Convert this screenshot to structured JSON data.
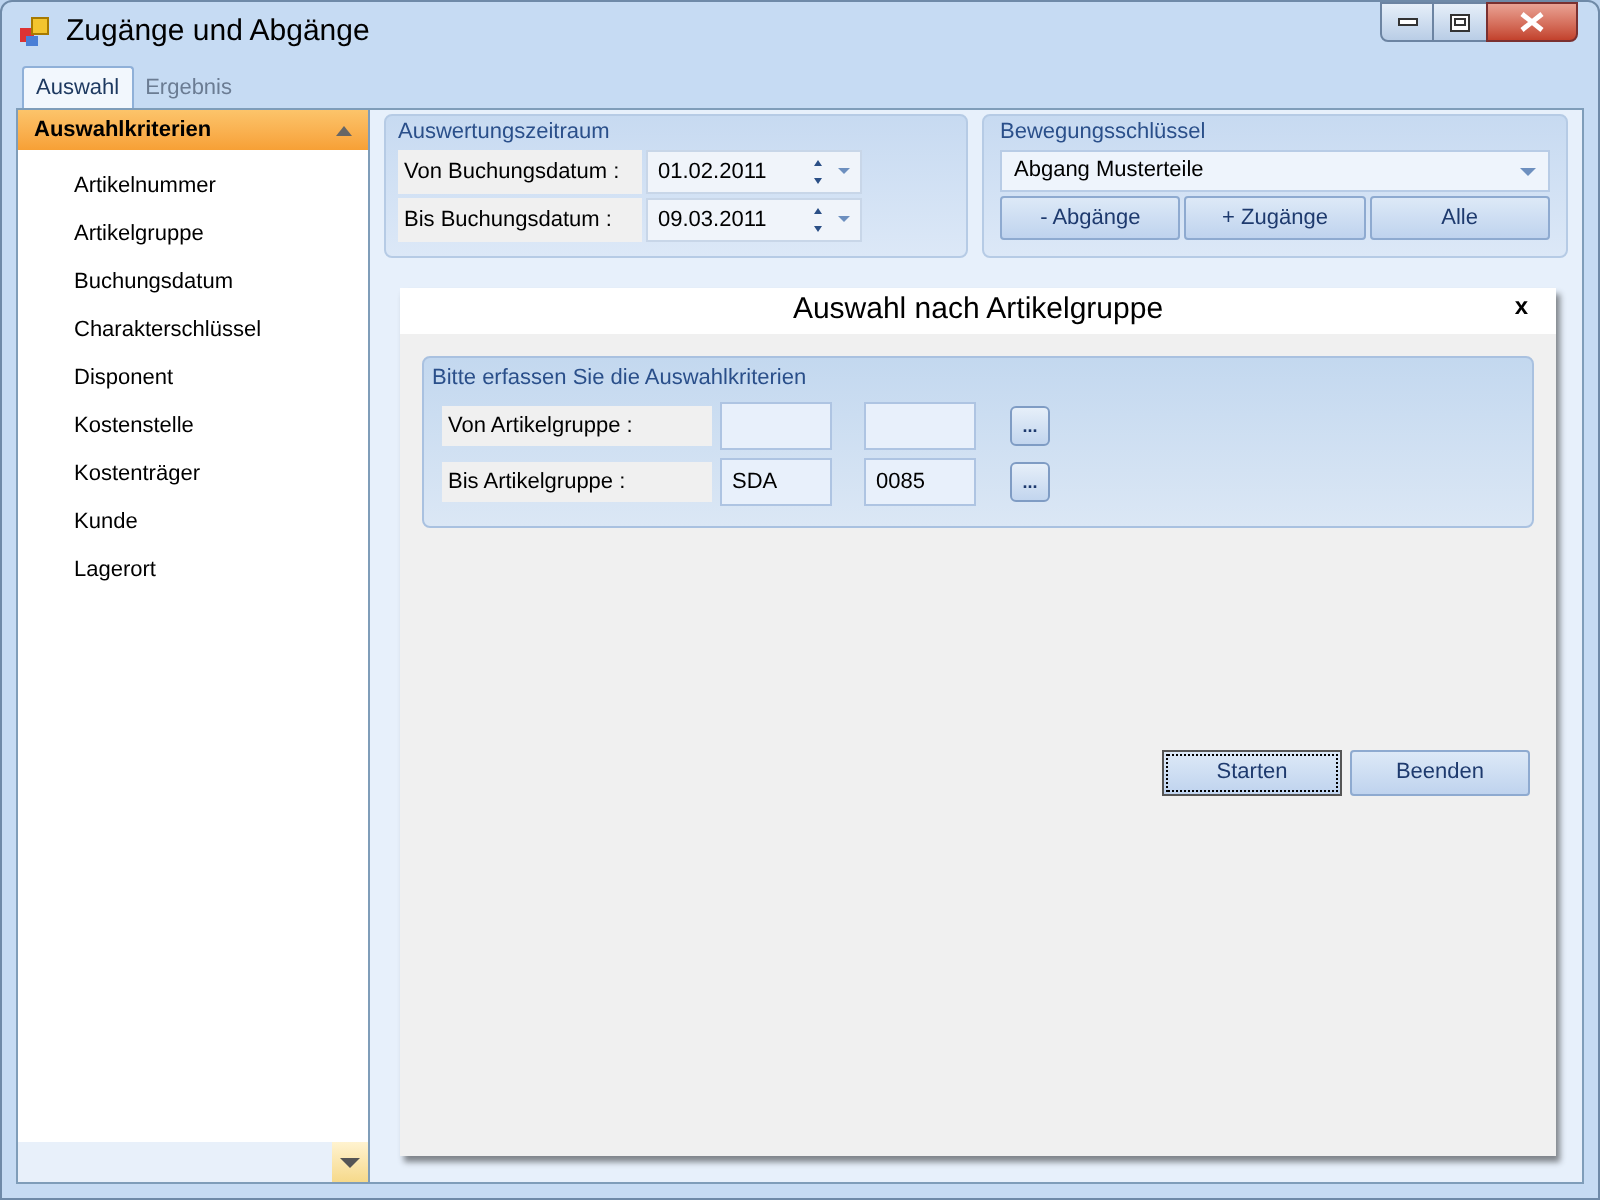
{
  "window": {
    "title": "Zugänge und Abgänge"
  },
  "tabs": [
    {
      "label": "Auswahl",
      "selected": true
    },
    {
      "label": "Ergebnis",
      "selected": false
    }
  ],
  "sidebar": {
    "header": "Auswahlkriterien",
    "items": [
      "Artikelnummer",
      "Artikelgruppe",
      "Buchungsdatum",
      "Charakterschlüssel",
      "Disponent",
      "Kostenstelle",
      "Kostenträger",
      "Kunde",
      "Lagerort"
    ]
  },
  "period": {
    "title": "Auswertungszeitraum",
    "rows": [
      {
        "label": "Von Buchungsdatum :",
        "value": "01.02.2011"
      },
      {
        "label": "Bis Buchungsdatum :",
        "value": "09.03.2011"
      }
    ]
  },
  "movement": {
    "title": "Bewegungsschlüssel",
    "selected": "Abgang Musterteile",
    "buttons": [
      "- Abgänge",
      "+ Zugänge",
      "Alle"
    ]
  },
  "dialog": {
    "title": "Auswahl nach Artikelgruppe",
    "close": "x",
    "group_title": "Bitte erfassen Sie die Auswahlkriterien",
    "rows": [
      {
        "label": "Von Artikelgruppe :",
        "browse": "..."
      },
      {
        "label": "Bis Artikelgruppe :",
        "value_1": "SDA",
        "value_2": "0085",
        "browse": "..."
      }
    ],
    "buttons": [
      {
        "label": "Starten",
        "focused": true
      },
      {
        "label": "Beenden",
        "focused": false
      }
    ]
  }
}
